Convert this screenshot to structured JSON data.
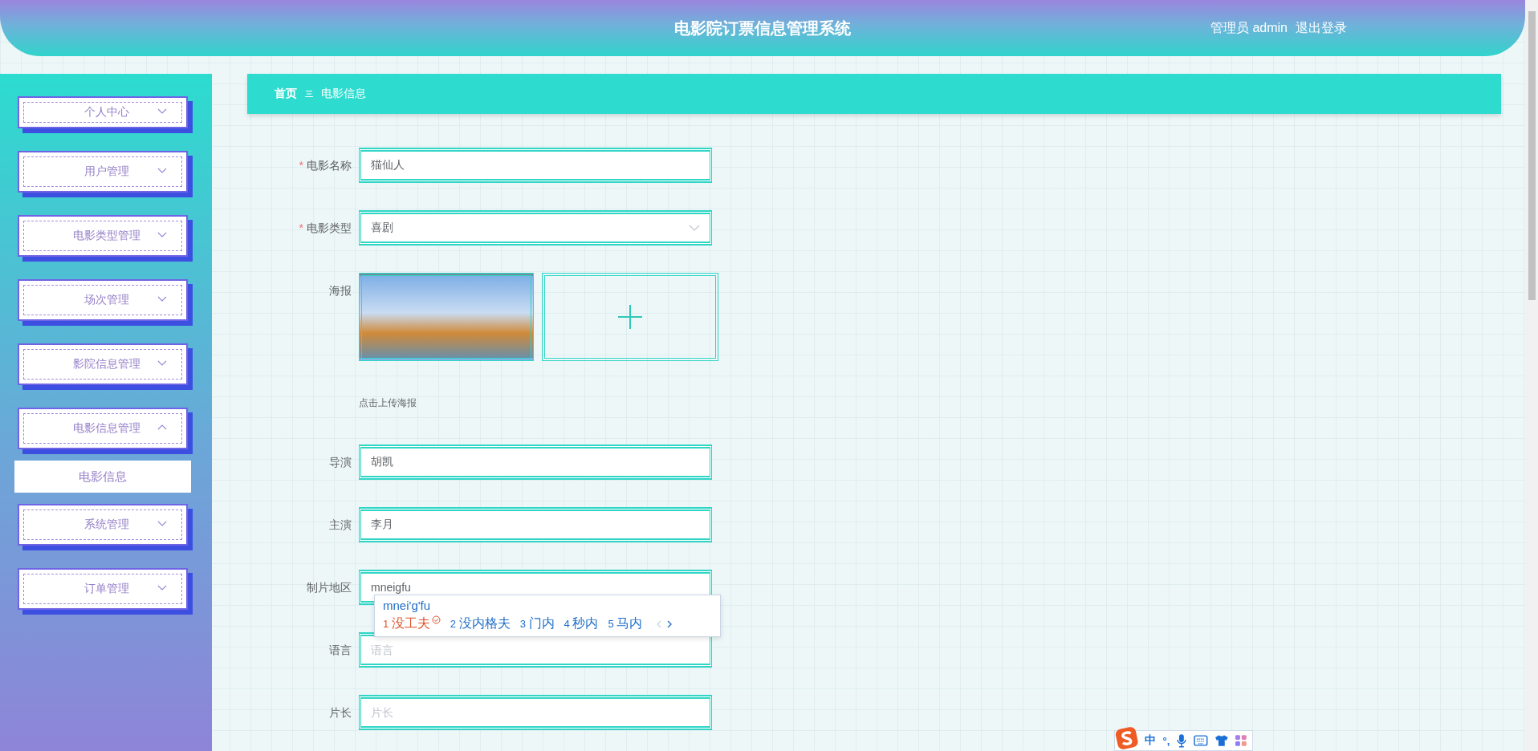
{
  "header": {
    "title": "电影院订票信息管理系统",
    "user_label": "管理员 admin",
    "logout": "退出登录"
  },
  "sidebar": {
    "items": [
      {
        "label": "个人中心",
        "expanded": false
      },
      {
        "label": "用户管理",
        "expanded": false
      },
      {
        "label": "电影类型管理",
        "expanded": false
      },
      {
        "label": "场次管理",
        "expanded": false
      },
      {
        "label": "影院信息管理",
        "expanded": false
      },
      {
        "label": "电影信息管理",
        "expanded": true,
        "children": [
          {
            "label": "电影信息",
            "selected": true
          }
        ]
      },
      {
        "label": "系统管理",
        "expanded": false
      },
      {
        "label": "订单管理",
        "expanded": false
      }
    ]
  },
  "breadcrumb": [
    {
      "label": "首页"
    },
    {
      "label": "电影信息"
    }
  ],
  "form": {
    "fields": [
      {
        "kind": "input",
        "required_mark": "*",
        "label": "电影名称",
        "value": "猫仙人"
      },
      {
        "kind": "select",
        "required_mark": "*",
        "label": "电影类型",
        "value": "喜剧"
      },
      {
        "kind": "upload",
        "label": "海报",
        "hint": "点击上传海报"
      },
      {
        "kind": "input",
        "label": "导演",
        "value": "胡凯"
      },
      {
        "kind": "input",
        "label": "主演",
        "value": "李月"
      },
      {
        "kind": "input",
        "label": "制片地区",
        "value": "mneigfu",
        "focused": true
      },
      {
        "kind": "input",
        "label": "语言",
        "placeholder": "语言"
      },
      {
        "kind": "input",
        "label": "片长",
        "placeholder": "片长"
      }
    ]
  },
  "ime": {
    "composition": "mnei'g'fu",
    "candidates": [
      {
        "index": "1",
        "text": "没工夫",
        "selected": true
      },
      {
        "index": "2",
        "text": "没内格夫",
        "selected": false
      },
      {
        "index": "3",
        "text": "门内",
        "selected": false
      },
      {
        "index": "4",
        "text": "秒内",
        "selected": false
      },
      {
        "index": "5",
        "text": "马内",
        "selected": false
      }
    ],
    "toolbar": {
      "mode": "中",
      "punctuation": "°,"
    }
  }
}
